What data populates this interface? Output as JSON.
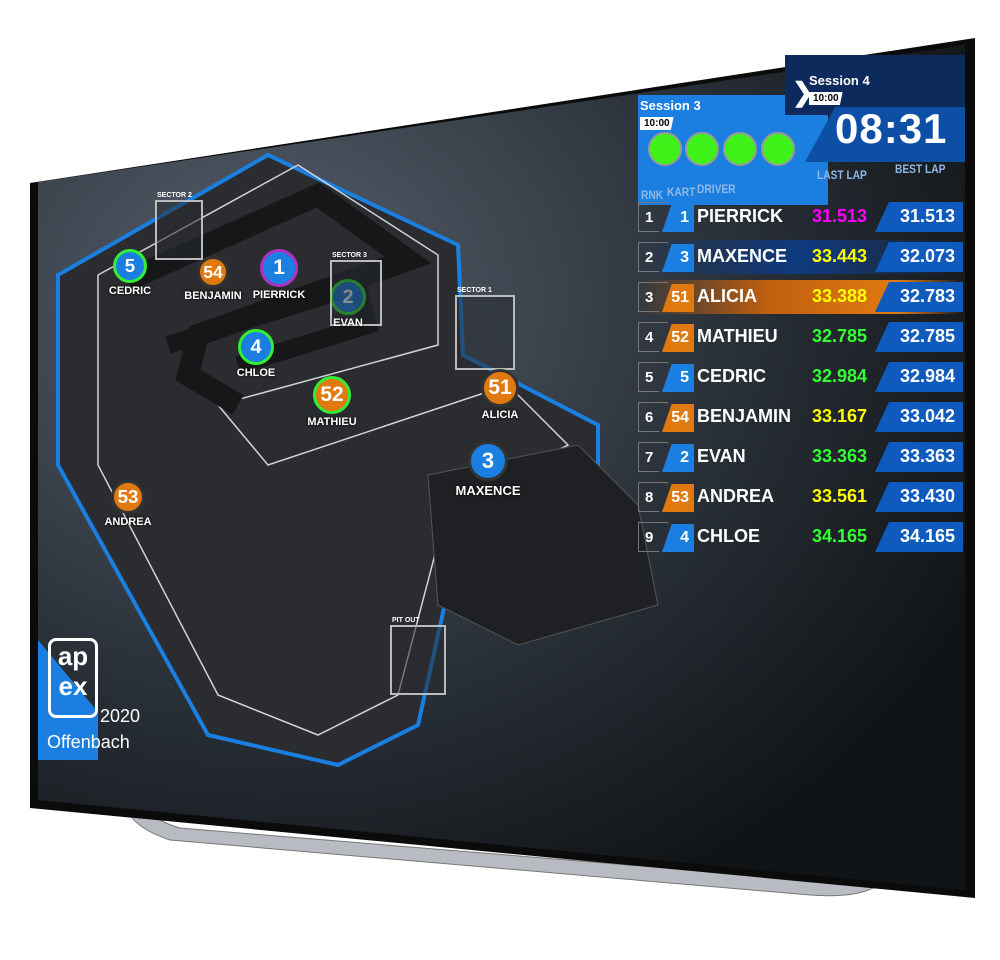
{
  "session_current": {
    "label": "Session 3",
    "duration": "10:00",
    "lights": 4,
    "light_color": "#3ff21a"
  },
  "session_next": {
    "label": "Session 4",
    "duration": "10:00",
    "arrow_icon": "chevron-right-icon"
  },
  "clock": "08:31",
  "columns": {
    "rank": "RNK",
    "kart": "KART",
    "driver": "DRIVER",
    "last": "LAST LAP",
    "best": "BEST LAP"
  },
  "colors": {
    "blue": "#1a7fe0",
    "orange": "#e07a10",
    "best_box": "#0e5bbd",
    "purple": "#ff00ff",
    "yellow": "#ffff00",
    "green": "#33ff33"
  },
  "rows": [
    {
      "rank": "1",
      "kart": "1",
      "driver": "PIERRICK",
      "last": "31.513",
      "best": "31.513",
      "team": "blue",
      "last_color": "#ff00ff"
    },
    {
      "rank": "2",
      "kart": "3",
      "driver": "MAXENCE",
      "last": "33.443",
      "best": "32.073",
      "team": "blue",
      "last_color": "#ffff00"
    },
    {
      "rank": "3",
      "kart": "51",
      "driver": "ALICIA",
      "last": "33.388",
      "best": "32.783",
      "team": "orange",
      "last_color": "#ffff00"
    },
    {
      "rank": "4",
      "kart": "52",
      "driver": "MATHIEU",
      "last": "32.785",
      "best": "32.785",
      "team": "orange",
      "last_color": "#33ff33"
    },
    {
      "rank": "5",
      "kart": "5",
      "driver": "CEDRIC",
      "last": "32.984",
      "best": "32.984",
      "team": "blue",
      "last_color": "#33ff33"
    },
    {
      "rank": "6",
      "kart": "54",
      "driver": "BENJAMIN",
      "last": "33.167",
      "best": "33.042",
      "team": "orange",
      "last_color": "#ffff00"
    },
    {
      "rank": "7",
      "kart": "2",
      "driver": "EVAN",
      "last": "33.363",
      "best": "33.363",
      "team": "blue",
      "last_color": "#33ff33"
    },
    {
      "rank": "8",
      "kart": "53",
      "driver": "ANDREA",
      "last": "33.561",
      "best": "33.430",
      "team": "orange",
      "last_color": "#ffff00"
    },
    {
      "rank": "9",
      "kart": "4",
      "driver": "CHLOE",
      "last": "34.165",
      "best": "34.165",
      "team": "blue",
      "last_color": "#33ff33"
    }
  ],
  "track": {
    "markers": [
      {
        "kart": "5",
        "name": "CEDRIC",
        "team": "blue",
        "ring": "#33ee33"
      },
      {
        "kart": "54",
        "name": "BENJAMIN",
        "team": "orange",
        "ring": ""
      },
      {
        "kart": "1",
        "name": "PIERRICK",
        "team": "blue",
        "ring": "#b030c0"
      },
      {
        "kart": "2",
        "name": "EVAN",
        "team": "blue",
        "ring": "#33ee33"
      },
      {
        "kart": "4",
        "name": "CHLOE",
        "team": "blue",
        "ring": "#33ee33"
      },
      {
        "kart": "52",
        "name": "MATHIEU",
        "team": "orange",
        "ring": "#33ee33"
      },
      {
        "kart": "51",
        "name": "ALICIA",
        "team": "orange",
        "ring": ""
      },
      {
        "kart": "3",
        "name": "MAXENCE",
        "team": "blue",
        "ring": ""
      },
      {
        "kart": "53",
        "name": "ANDREA",
        "team": "orange",
        "ring": ""
      }
    ],
    "sectors": [
      "SECTOR 2",
      "SECTOR 3",
      "SECTOR 1",
      "PIT OUT"
    ]
  },
  "branding": {
    "logo": "apex timing",
    "year": "2020",
    "venue": "Offenbach"
  }
}
